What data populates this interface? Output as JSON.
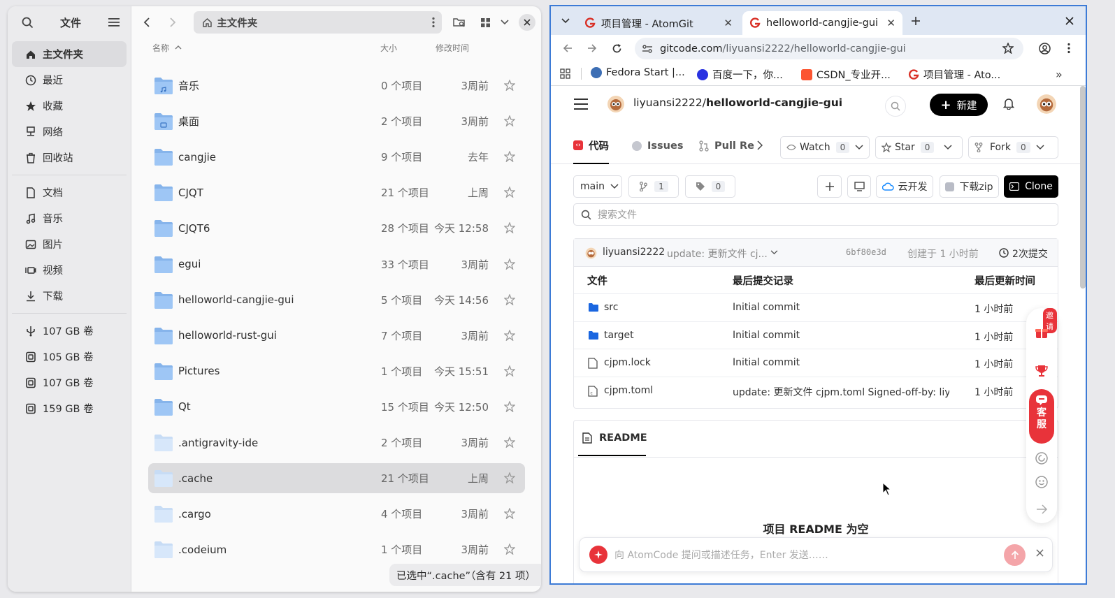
{
  "file_manager": {
    "sidebar": {
      "title": "文件",
      "places": [
        {
          "label": "主文件夹",
          "icon": "home-icon",
          "active": true
        },
        {
          "label": "最近",
          "icon": "clock-icon"
        },
        {
          "label": "收藏",
          "icon": "star-icon"
        },
        {
          "label": "网络",
          "icon": "network-icon"
        },
        {
          "label": "回收站",
          "icon": "trash-icon"
        }
      ],
      "folders": [
        {
          "label": "文档",
          "icon": "document-icon"
        },
        {
          "label": "音乐",
          "icon": "music-icon"
        },
        {
          "label": "图片",
          "icon": "picture-icon"
        },
        {
          "label": "视频",
          "icon": "video-icon"
        },
        {
          "label": "下载",
          "icon": "download-icon"
        }
      ],
      "volumes": [
        {
          "label": "107 GB 卷",
          "icon": "usb-icon"
        },
        {
          "label": "105 GB 卷",
          "icon": "drive-icon"
        },
        {
          "label": "107 GB 卷",
          "icon": "drive-icon"
        },
        {
          "label": "159 GB 卷",
          "icon": "drive-icon"
        }
      ]
    },
    "path": "主文件夹",
    "columns": {
      "name": "名称",
      "size": "大小",
      "modified": "修改时间"
    },
    "rows": [
      {
        "name": "音乐",
        "size": "0 个项目",
        "modified": "3周前",
        "type": "music"
      },
      {
        "name": "桌面",
        "size": "2 个项目",
        "modified": "3周前",
        "type": "desktop"
      },
      {
        "name": "cangjie",
        "size": "9 个项目",
        "modified": "去年",
        "type": "folder"
      },
      {
        "name": "CJQT",
        "size": "21 个项目",
        "modified": "上周",
        "type": "folder"
      },
      {
        "name": "CJQT6",
        "size": "28 个项目",
        "modified": "今天 12:58",
        "type": "folder"
      },
      {
        "name": "egui",
        "size": "33 个项目",
        "modified": "3周前",
        "type": "folder"
      },
      {
        "name": "helloworld-cangjie-gui",
        "size": "5 个项目",
        "modified": "今天 14:56",
        "type": "folder"
      },
      {
        "name": "helloworld-rust-gui",
        "size": "7 个项目",
        "modified": "3周前",
        "type": "folder"
      },
      {
        "name": "Pictures",
        "size": "1 个项目",
        "modified": "今天 15:51",
        "type": "folder"
      },
      {
        "name": "Qt",
        "size": "15 个项目",
        "modified": "今天 12:50",
        "type": "folder"
      },
      {
        "name": ".antigravity-ide",
        "size": "2 个项目",
        "modified": "3周前",
        "type": "hidden"
      },
      {
        "name": ".cache",
        "size": "21 个项目",
        "modified": "上周",
        "type": "hidden",
        "selected": true
      },
      {
        "name": ".cargo",
        "size": "4 个项目",
        "modified": "3周前",
        "type": "hidden"
      },
      {
        "name": ".codeium",
        "size": "1 个项目",
        "modified": "3周前",
        "type": "hidden"
      }
    ],
    "status": "已选中“.cache”（含有 21 项）"
  },
  "browser": {
    "tabs": [
      {
        "title": "项目管理 - AtomGit",
        "active": false
      },
      {
        "title": "helloworld-cangjie-gui",
        "active": true
      }
    ],
    "url_host": "gitcode.com",
    "url_path": "/liyuansi2222/helloworld-cangjie-gui",
    "bookmarks": [
      {
        "label": "Fedora Start |...",
        "color": "#3c6eb4"
      },
      {
        "label": "百度一下，你...",
        "color": "#2932e1"
      },
      {
        "label": "CSDN_专业开...",
        "color": "#fc5531"
      },
      {
        "label": "项目管理 - Ato...",
        "color": "#d93026"
      }
    ]
  },
  "gitcode": {
    "repo_owner": "liyuansi2222/",
    "repo_name": "helloworld-cangjie-gui",
    "new_button": "新建",
    "nav": {
      "code": "代码",
      "issues": "Issues",
      "pulls": "Pull Re"
    },
    "watch": {
      "label": "Watch",
      "count": "0"
    },
    "star": {
      "label": "Star",
      "count": "0"
    },
    "fork": {
      "label": "Fork",
      "count": "0"
    },
    "branch": "main",
    "branch_count": "1",
    "tag_count": "0",
    "cloud_dev": "云开发",
    "download_zip": "下载zip",
    "clone": "Clone",
    "search_placeholder": "搜索文件",
    "commit": {
      "author": "liyuansi2222",
      "message": "update: 更新文件 cj...",
      "hash": "6bf80e3d",
      "created": "创建于 1 小时前",
      "count": "2次提交"
    },
    "table_headers": {
      "file": "文件",
      "last_commit": "最后提交记录",
      "updated": "最后更新时间"
    },
    "files": [
      {
        "name": "src",
        "type": "folder",
        "commit": "Initial commit",
        "time": "1 小时前"
      },
      {
        "name": "target",
        "type": "folder",
        "commit": "Initial commit",
        "time": "1 小时前"
      },
      {
        "name": "cjpm.lock",
        "type": "file",
        "commit": "Initial commit",
        "time": "1 小时前"
      },
      {
        "name": "cjpm.toml",
        "type": "toml",
        "commit": "update: 更新文件 cjpm.toml Signed-off-by: liyua...",
        "time": "1 小时前"
      }
    ],
    "readme_tab": "README",
    "readme_empty": "项目 README 为空",
    "chat_placeholder": "向 AtomCode 提问或描述任务，Enter 发送……",
    "float": {
      "invite": "邀请",
      "service": "客服"
    }
  }
}
